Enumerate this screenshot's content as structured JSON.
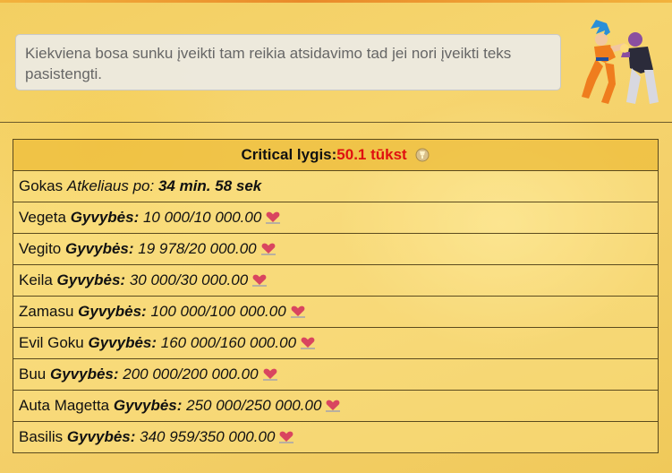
{
  "info": {
    "text": "Kiekviena bosa sunku įveikti tam reikia atsidavimo tad jei nori įveikti teks pasistengti."
  },
  "header": {
    "label": "Critical lygis:",
    "value": "50.1 tūkst"
  },
  "gokas": {
    "name": "Gokas",
    "arrives": "Atkeliaus po:",
    "time": "34 min. 58 sek"
  },
  "boss_label": "Gyvybės:",
  "bosses": [
    {
      "name": "Vegeta",
      "hp": "10 000/10 000.00"
    },
    {
      "name": "Vegito",
      "hp": "19 978/20 000.00"
    },
    {
      "name": "Keila",
      "hp": "30 000/30 000.00"
    },
    {
      "name": "Zamasu",
      "hp": "100 000/100 000.00"
    },
    {
      "name": "Evil Goku",
      "hp": "160 000/160 000.00"
    },
    {
      "name": "Buu",
      "hp": "200 000/200 000.00"
    },
    {
      "name": "Auta Magetta",
      "hp": "250 000/250 000.00"
    },
    {
      "name": "Basilis",
      "hp": "340 959/350 000.00"
    }
  ],
  "colors": {
    "accent_red": "#e01010",
    "heart": "#d9455f"
  },
  "icons": {
    "heart": "heart-icon",
    "badge": "trophy-icon",
    "fighters": "fighters-image"
  }
}
